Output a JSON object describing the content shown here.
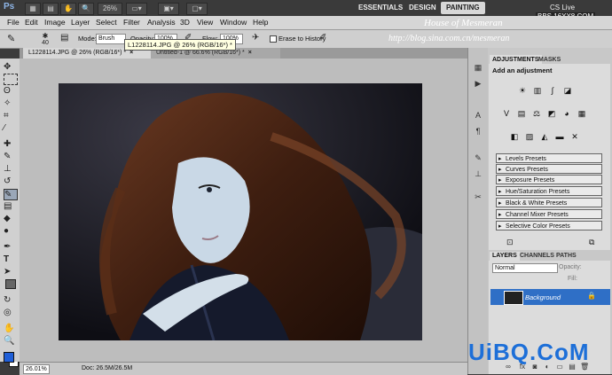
{
  "titlebar": {
    "app_logo": "Ps",
    "zoom": "26%",
    "workspaces": [
      "ESSENTIALS",
      "DESIGN",
      "PAINTING"
    ],
    "active_workspace": "PAINTING",
    "cs_live": "CS Live"
  },
  "watermarks": {
    "line1": "House of Mesmeran",
    "line2": "http://blog.sina.com.cn/mesmeran",
    "site": "BBS.16XX8.COM"
  },
  "menu": [
    "File",
    "Edit",
    "Image",
    "Layer",
    "Select",
    "Filter",
    "Analysis",
    "3D",
    "View",
    "Window",
    "Help"
  ],
  "options": {
    "brush_size": "40",
    "mode_label": "Mode:",
    "mode_value": "Brush",
    "opacity_label": "Opacity:",
    "opacity_value": "100%",
    "flow_label": "Flow:",
    "flow_value": "100%",
    "erase_label": "Erase to History"
  },
  "tooltip": "L1228114.JPG @ 26% (RGB/16*) *",
  "tabs": [
    {
      "label": "L1228114.JPG @ 26% (RGB/16*) *"
    },
    {
      "label": "Untitled-1 @ 66.6% (RGB/16*) *"
    }
  ],
  "status": {
    "zoom": "26.01%",
    "doc": "Doc: 26.5M/26.5M"
  },
  "adjustments": {
    "tab_active": "ADJUSTMENTS",
    "tab_other": "MASKS",
    "title": "Add an adjustment",
    "presets": [
      "Levels Presets",
      "Curves Presets",
      "Exposure Presets",
      "Hue/Saturation Presets",
      "Black & White Presets",
      "Channel Mixer Presets",
      "Selective Color Presets"
    ]
  },
  "layers": {
    "tabs": [
      "LAYERS",
      "CHANNELS",
      "PATHS"
    ],
    "blend_mode": "Normal",
    "opacity_label": "Opacity:",
    "fill_label": "Fill:",
    "layer_name": "Background"
  },
  "logo_text": "UiBQ.CoM",
  "colors": {
    "accent": "#2f6fc6",
    "chrome": "#3a3a3a",
    "canvas_bg": "#bdbdbd"
  }
}
